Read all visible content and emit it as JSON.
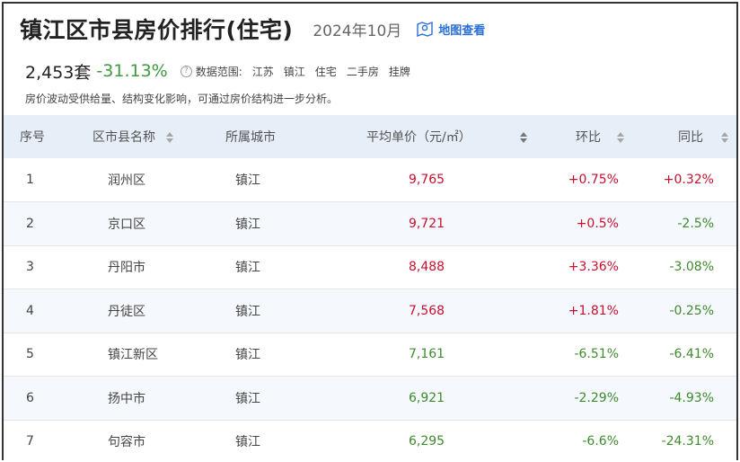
{
  "header": {
    "title": "镇江区市县房价排行(住宅)",
    "date": "2024年10月",
    "map_link": "地图查看"
  },
  "summary": {
    "count": "2,453套",
    "change": "-31.13%",
    "scope_label": "数据范围:",
    "tags": [
      "江苏",
      "镇江",
      "住宅",
      "二手房",
      "挂牌"
    ]
  },
  "note": "房价波动受供给量、结构变化影响，可通过房价结构进一步分析。",
  "table": {
    "columns": {
      "idx": "序号",
      "district": "区市县名称",
      "city": "所属城市",
      "price": "平均单价（元/㎡）",
      "mom": "环比",
      "yoy": "同比"
    },
    "rows": [
      {
        "idx": "1",
        "district": "润州区",
        "city": "镇江",
        "price": "9,765",
        "mom": "+0.75%",
        "yoy": "+0.32%"
      },
      {
        "idx": "2",
        "district": "京口区",
        "city": "镇江",
        "price": "9,721",
        "mom": "+0.5%",
        "yoy": "-2.5%"
      },
      {
        "idx": "3",
        "district": "丹阳市",
        "city": "镇江",
        "price": "8,488",
        "mom": "+3.36%",
        "yoy": "-3.08%"
      },
      {
        "idx": "4",
        "district": "丹徒区",
        "city": "镇江",
        "price": "7,568",
        "mom": "+1.81%",
        "yoy": "-0.25%"
      },
      {
        "idx": "5",
        "district": "镇江新区",
        "city": "镇江",
        "price": "7,161",
        "mom": "-6.51%",
        "yoy": "-6.41%"
      },
      {
        "idx": "6",
        "district": "扬中市",
        "city": "镇江",
        "price": "6,921",
        "mom": "-2.29%",
        "yoy": "-4.93%"
      },
      {
        "idx": "7",
        "district": "句容市",
        "city": "镇江",
        "price": "6,295",
        "mom": "-6.6%",
        "yoy": "-24.31%"
      }
    ]
  },
  "colors": {
    "up": "#c8102e",
    "down": "#3f8a2f",
    "header_bg": "#e6eef8",
    "link": "#2a6fd6"
  }
}
